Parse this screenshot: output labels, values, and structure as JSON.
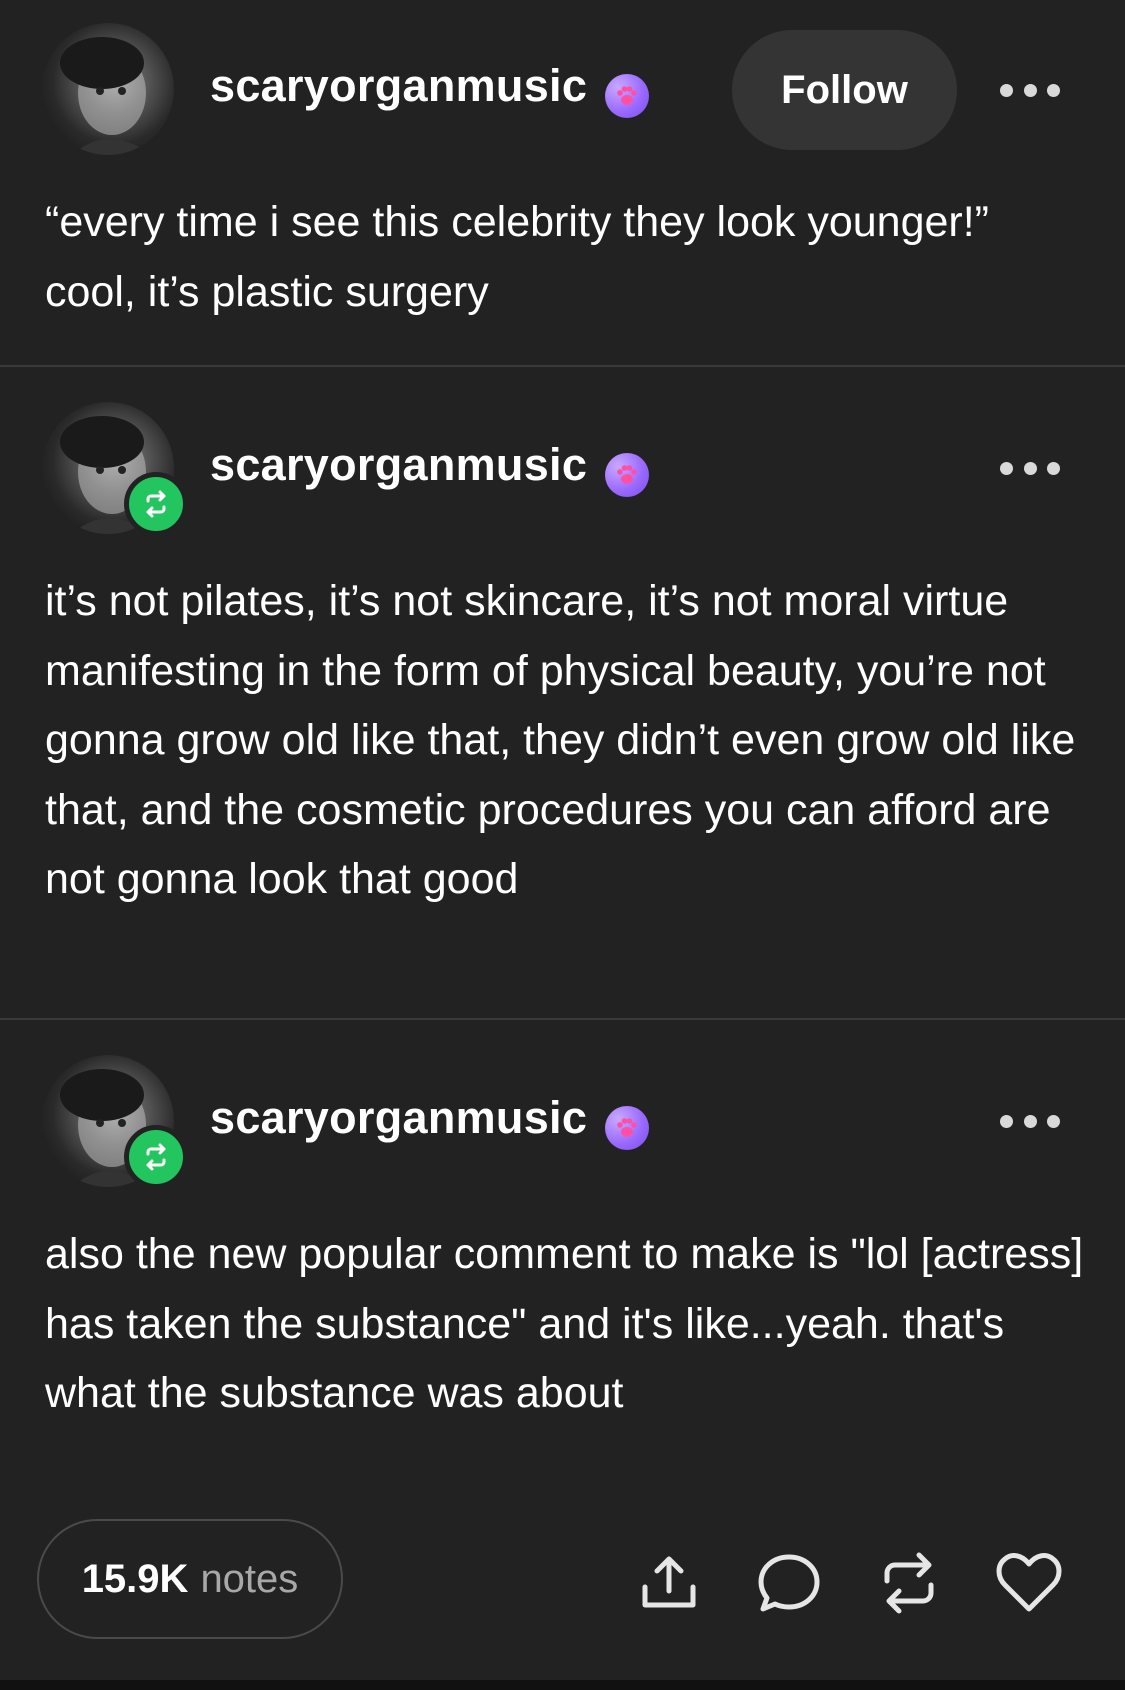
{
  "posts": [
    {
      "username": "scaryorganmusic",
      "follow_label": "Follow",
      "text": "“every time i see this celebrity they look younger!” cool, it’s plastic surgery",
      "avatar_icon": "avatar-photo",
      "badge_icon": "paw-icon"
    },
    {
      "username": "scaryorganmusic",
      "reblog_icon": "reblog-icon",
      "text": "it’s not pilates, it’s not skincare, it’s not moral virtue manifesting in the form of physical beauty, you’re not gonna grow old like that, they didn’t even grow old like that, and the cosmetic procedures you can afford are not gonna look that good",
      "badge_icon": "paw-icon"
    },
    {
      "username": "scaryorganmusic",
      "reblog_icon": "reblog-icon",
      "text": "also the new popular comment to make is \"lol [actress] has taken the substance\" and it's like...yeah. that's what the substance was about",
      "badge_icon": "paw-icon"
    }
  ],
  "footer": {
    "notes_count": "15.9K",
    "notes_label": "notes",
    "actions": [
      "share-icon",
      "comment-icon",
      "reblog-icon",
      "heart-icon"
    ]
  },
  "colors": {
    "background": "#222223",
    "reblog_badge": "#22c55e",
    "verified_badge": "#9b6bff",
    "text": "#ffffff",
    "muted": "#a8a8a8"
  }
}
